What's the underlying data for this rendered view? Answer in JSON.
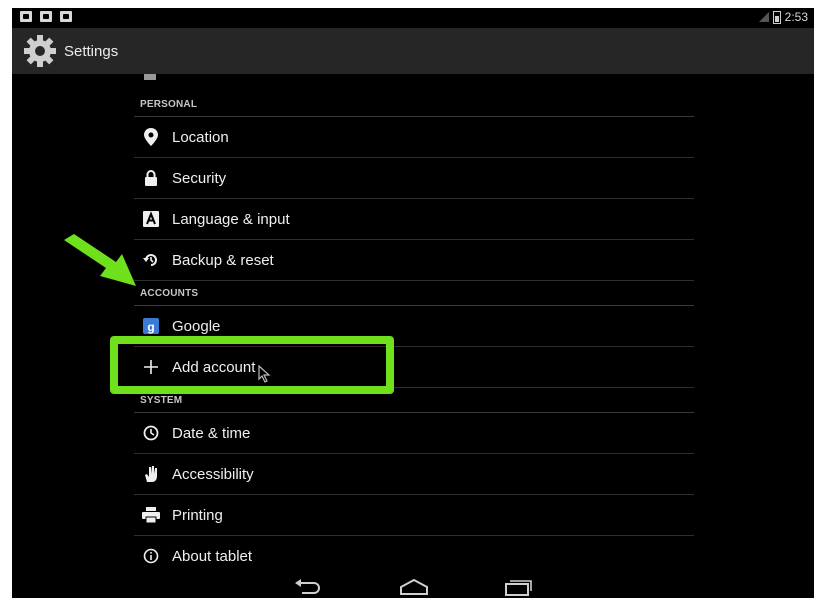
{
  "status_bar": {
    "time": "2:53"
  },
  "action_bar": {
    "title": "Settings",
    "icon": "gear-icon"
  },
  "sections": {
    "personal": {
      "header": "PERSONAL",
      "items": [
        {
          "label": "Location",
          "icon": "location-pin-icon"
        },
        {
          "label": "Security",
          "icon": "lock-icon"
        },
        {
          "label": "Language & input",
          "icon": "keyboard-icon"
        },
        {
          "label": "Backup & reset",
          "icon": "backup-reset-icon"
        }
      ]
    },
    "accounts": {
      "header": "ACCOUNTS",
      "items": [
        {
          "label": "Google",
          "icon": "google-icon"
        },
        {
          "label": "Add account",
          "icon": "plus-icon"
        }
      ]
    },
    "system": {
      "header": "SYSTEM",
      "items": [
        {
          "label": "Date & time",
          "icon": "clock-icon"
        },
        {
          "label": "Accessibility",
          "icon": "hand-icon"
        },
        {
          "label": "Printing",
          "icon": "printer-icon"
        },
        {
          "label": "About tablet",
          "icon": "info-icon"
        }
      ]
    }
  },
  "annotation": {
    "highlight_color": "#6ee01c",
    "arrow_color": "#6ee01c"
  },
  "nav": {
    "back": "back-icon",
    "home": "home-icon",
    "recents": "recents-icon"
  }
}
